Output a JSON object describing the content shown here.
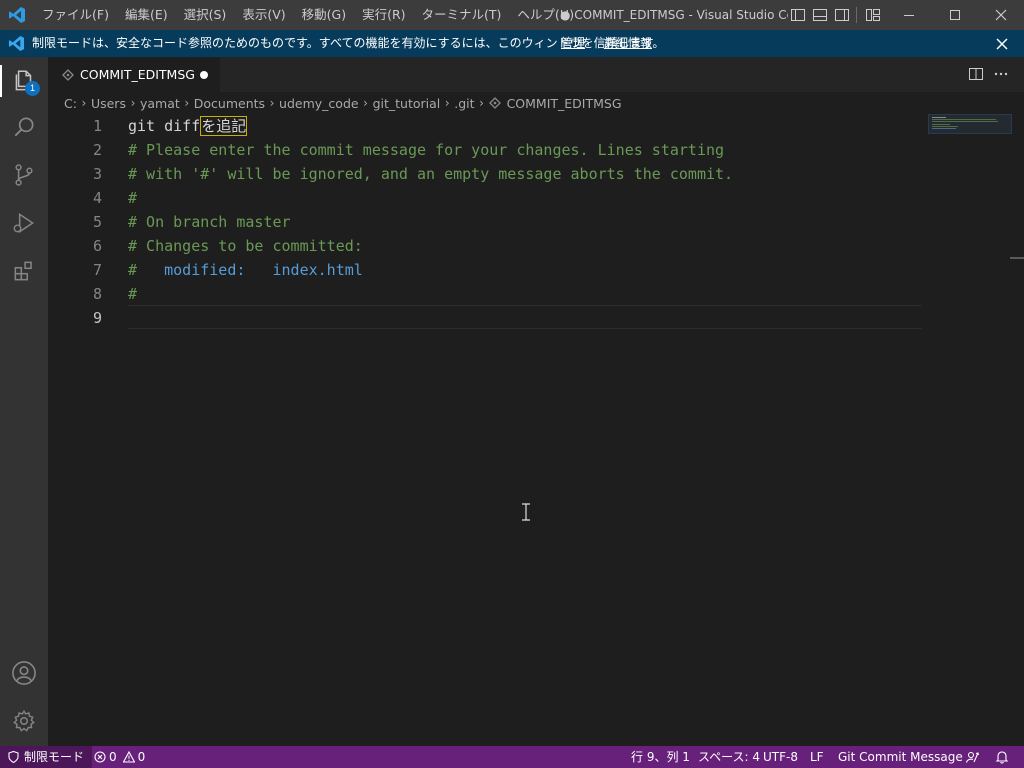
{
  "menubar": {
    "items": [
      "ファイル(F)",
      "編集(E)",
      "選択(S)",
      "表示(V)",
      "移動(G)",
      "実行(R)",
      "ターミナル(T)",
      "ヘルプ(H)"
    ]
  },
  "window_title": "● COMMIT_EDITMSG - Visual Studio Co...",
  "banner": {
    "text": "制限モードは、安全なコード参照のためのものです。すべての機能を有効にするには、このウィンドウを信頼します。",
    "manage": "管理",
    "details": "詳細情報"
  },
  "activity": {
    "badge": "1"
  },
  "tab": {
    "label": "COMMIT_EDITMSG"
  },
  "breadcrumbs": [
    "C:",
    "Users",
    "yamat",
    "Documents",
    "udemy_code",
    "git_tutorial",
    ".git",
    "COMMIT_EDITMSG"
  ],
  "editor": {
    "line_numbers": [
      "1",
      "2",
      "3",
      "4",
      "5",
      "6",
      "7",
      "8",
      "9"
    ],
    "line1_text": "git diff",
    "line1_ime": "を追記",
    "lines": [
      "# Please enter the commit message for your changes. Lines starting",
      "# with '#' will be ignored, and an empty message aborts the commit.",
      "#",
      "# On branch master",
      "# Changes to be committed:"
    ],
    "line7_hash": "#",
    "line7_status": "modified:",
    "line7_file": "index.html",
    "line8": "#"
  },
  "statusbar": {
    "restricted": "制限モード",
    "errors": "0",
    "warnings": "0",
    "position": "行 9、列 1",
    "spaces": "スペース: 4",
    "encoding": "UTF-8",
    "eol": "LF",
    "language": "Git Commit Message"
  },
  "colors": {
    "titlebar": "#3c3c3c",
    "banner": "#063b5c",
    "activitybar": "#333333",
    "editor_bg": "#1e1e1e",
    "statusbar": "#68217a",
    "comment": "#6a9955",
    "keyword": "#569cd6"
  }
}
